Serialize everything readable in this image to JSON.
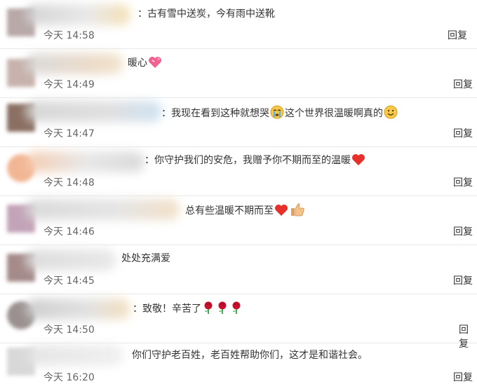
{
  "comments": [
    {
      "text": "古有雪中送炭，今有雨中送靴",
      "separator": "：",
      "time_label": "今天",
      "time": "14:58",
      "reply_label": "回复",
      "emojis_after": []
    },
    {
      "text": "暖心",
      "separator": "",
      "time_label": "今天",
      "time": "14:49",
      "reply_label": "回复",
      "emojis_after": [
        "heart-gift-emoji"
      ]
    },
    {
      "text_part1": "我现在看到这种就想哭",
      "text_part2": "这个世界很温暖啊真的",
      "separator": "：",
      "time_label": "今天",
      "time": "14:47",
      "reply_label": "回复",
      "emojis": [
        "crying-emoji",
        "smile-emoji"
      ]
    },
    {
      "text": "你守护我们的安危，我赠予你不期而至的温暖",
      "separator": "：",
      "time_label": "今天",
      "time": "14:48",
      "reply_label": "回复",
      "emojis_after": [
        "red-heart-emoji"
      ]
    },
    {
      "text": "总有些温暖不期而至",
      "separator": "",
      "time_label": "今天",
      "time": "14:46",
      "reply_label": "回复",
      "emojis_after": [
        "red-heart-emoji",
        "thumbs-up-emoji"
      ]
    },
    {
      "text": "处处充满爱",
      "separator": "",
      "time_label": "今天",
      "time": "14:45",
      "reply_label": "回复",
      "emojis_after": []
    },
    {
      "text": "致敬！辛苦了",
      "separator": "：",
      "time_label": "今天",
      "time": "14:50",
      "reply_label": "回复",
      "emojis_after": [
        "rose-emoji",
        "rose-emoji",
        "rose-emoji"
      ]
    },
    {
      "text": "你们守护老百姓，老百姓帮助你们，这才是和谐社会。",
      "separator": "",
      "time_label": "今天",
      "time": "16:20",
      "reply_label": "回复",
      "emojis_after": []
    }
  ]
}
